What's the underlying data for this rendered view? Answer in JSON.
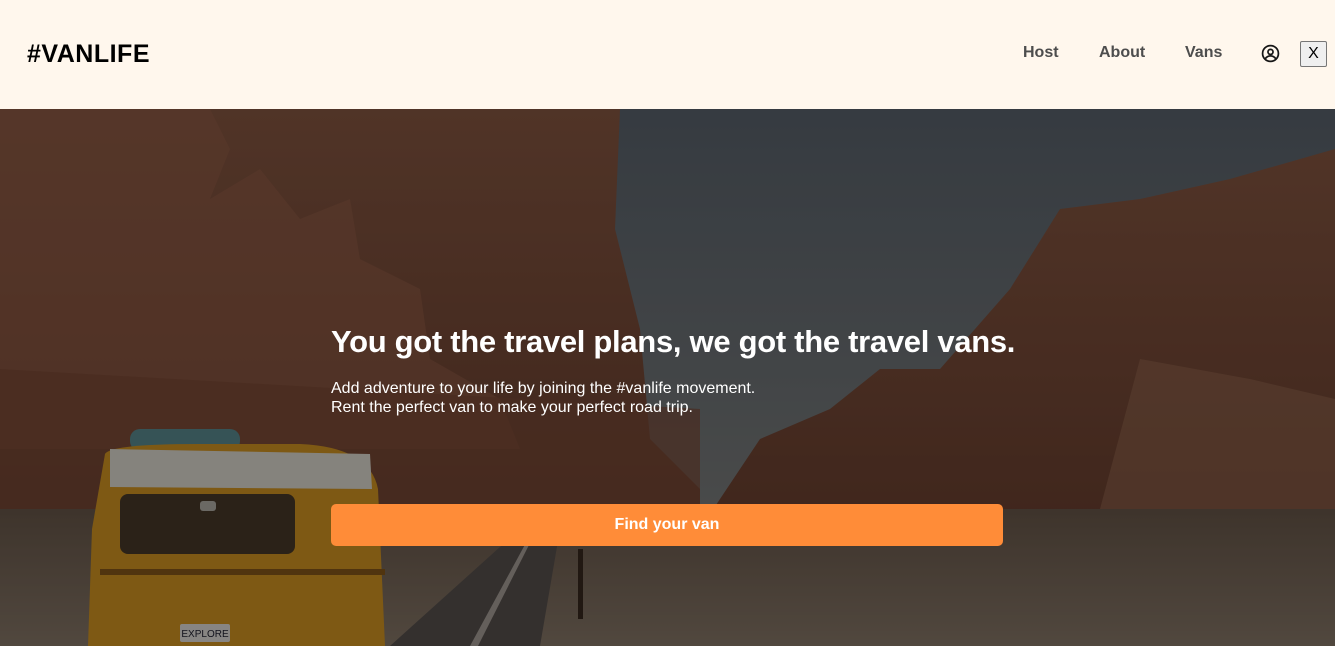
{
  "header": {
    "logo": "#VANLIFE",
    "nav": [
      {
        "label": "Host"
      },
      {
        "label": "About"
      },
      {
        "label": "Vans"
      }
    ],
    "user_icon": "user-circle-icon",
    "close_label": "X"
  },
  "hero": {
    "title": "You got the travel plans, we got the travel vans.",
    "subtitle_line1": "Add adventure to your life by joining the #vanlife movement.",
    "subtitle_line2": "Rent the perfect van to make your perfect road trip.",
    "cta_label": "Find your van",
    "van_plate": "EXPLORE"
  },
  "colors": {
    "header_bg": "#FFF7ED",
    "cta_bg": "#FF8C38",
    "nav_text": "#4D4D4D"
  }
}
